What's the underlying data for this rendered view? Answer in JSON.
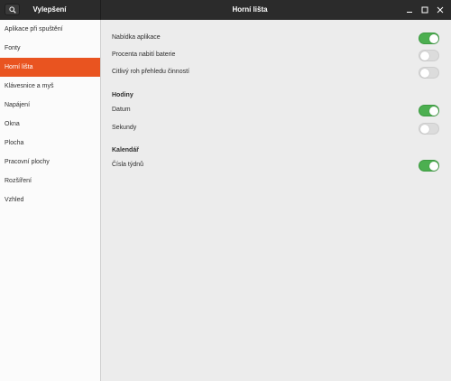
{
  "window": {
    "app_title": "Vylepšení",
    "page_title": "Horní lišta"
  },
  "sidebar": {
    "items": [
      {
        "label": "Aplikace při spuštění",
        "active": false
      },
      {
        "label": "Fonty",
        "active": false
      },
      {
        "label": "Horní lišta",
        "active": true
      },
      {
        "label": "Klávesnice a myš",
        "active": false
      },
      {
        "label": "Napájení",
        "active": false
      },
      {
        "label": "Okna",
        "active": false
      },
      {
        "label": "Plocha",
        "active": false
      },
      {
        "label": "Pracovní plochy",
        "active": false
      },
      {
        "label": "Rozšíření",
        "active": false
      },
      {
        "label": "Vzhled",
        "active": false
      }
    ]
  },
  "settings": {
    "app_menu": {
      "label": "Nabídka aplikace",
      "on": true
    },
    "battery_percent": {
      "label": "Procenta nabití baterie",
      "on": false
    },
    "hot_corner": {
      "label": "Citlivý roh přehledu činností",
      "on": false
    },
    "clock_title": "Hodiny",
    "date": {
      "label": "Datum",
      "on": true
    },
    "seconds": {
      "label": "Sekundy",
      "on": false
    },
    "calendar_title": "Kalendář",
    "week_numbers": {
      "label": "Čísla týdnů",
      "on": true
    }
  },
  "colors": {
    "accent": "#e95420",
    "toggle_on": "#4caf50",
    "headerbar": "#2b2b2b"
  },
  "icons": {
    "search": "search-icon",
    "minimize": "minimize-icon",
    "maximize": "maximize-icon",
    "close": "close-icon"
  }
}
